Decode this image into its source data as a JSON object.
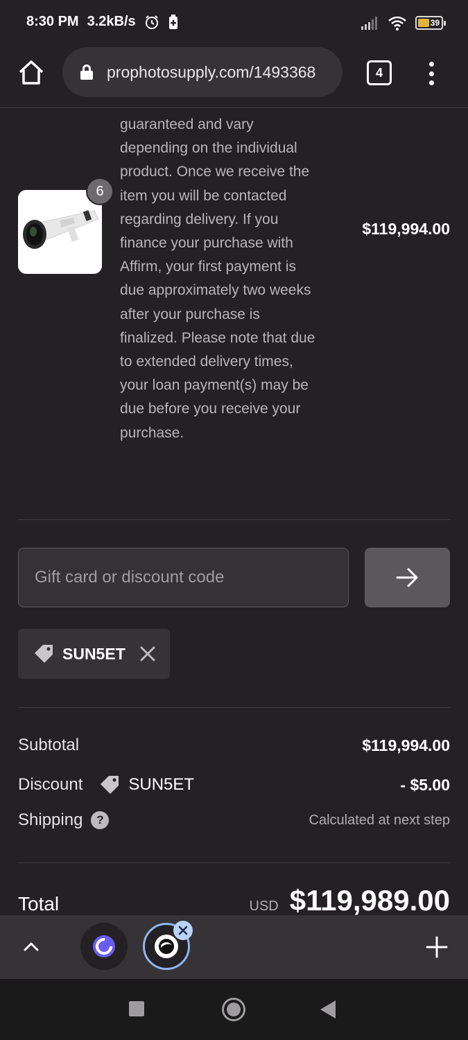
{
  "status_bar": {
    "time": "8:30 PM",
    "net_speed": "3.2kB/s",
    "battery": "39",
    "icons": [
      "alarm-icon",
      "battery-saver-icon",
      "signal-icon",
      "wifi-icon",
      "battery-icon"
    ]
  },
  "browser": {
    "url": "prophotosupply.com/1493368",
    "tab_count": "4",
    "icons": [
      "home-icon",
      "lock-icon",
      "tabs-icon",
      "more-vert-icon"
    ]
  },
  "product": {
    "description": "guaranteed and vary depending on the individual product. Once we receive the item you will be contacted regarding delivery. If you finance your purchase with Affirm, your first payment is due approximately two weeks after your purchase is finalized. Please note that due to extended delivery times, your loan payment(s) may be due before you receive your purchase.",
    "quantity": "6",
    "price": "$119,994.00",
    "image": "telephoto-lens-image"
  },
  "discount": {
    "placeholder": "Gift card or discount code",
    "applied_code": "SUN5ET",
    "icons": [
      "arrow-right-icon",
      "tag-icon",
      "close-icon"
    ]
  },
  "summary": {
    "subtotal_label": "Subtotal",
    "subtotal_value": "$119,994.00",
    "discount_label": "Discount",
    "discount_code": "SUN5ET",
    "discount_value": "- $5.00",
    "shipping_label": "Shipping",
    "shipping_value": "Calculated at next step",
    "total_label": "Total",
    "currency": "USD",
    "total_value": "$119,989.00"
  },
  "bottom_bar": {
    "icons": [
      "chevron-up-icon",
      "tab-thumbnail-icon",
      "tab-thumbnail-active-icon",
      "close-icon",
      "plus-icon"
    ]
  },
  "nav": {
    "icons": [
      "recents-icon",
      "home-icon",
      "back-icon"
    ]
  },
  "colors": {
    "background": "#242124",
    "surface": "#363336",
    "text_muted": "#b8b5b8",
    "accent_tab": "#8fb6f0"
  }
}
